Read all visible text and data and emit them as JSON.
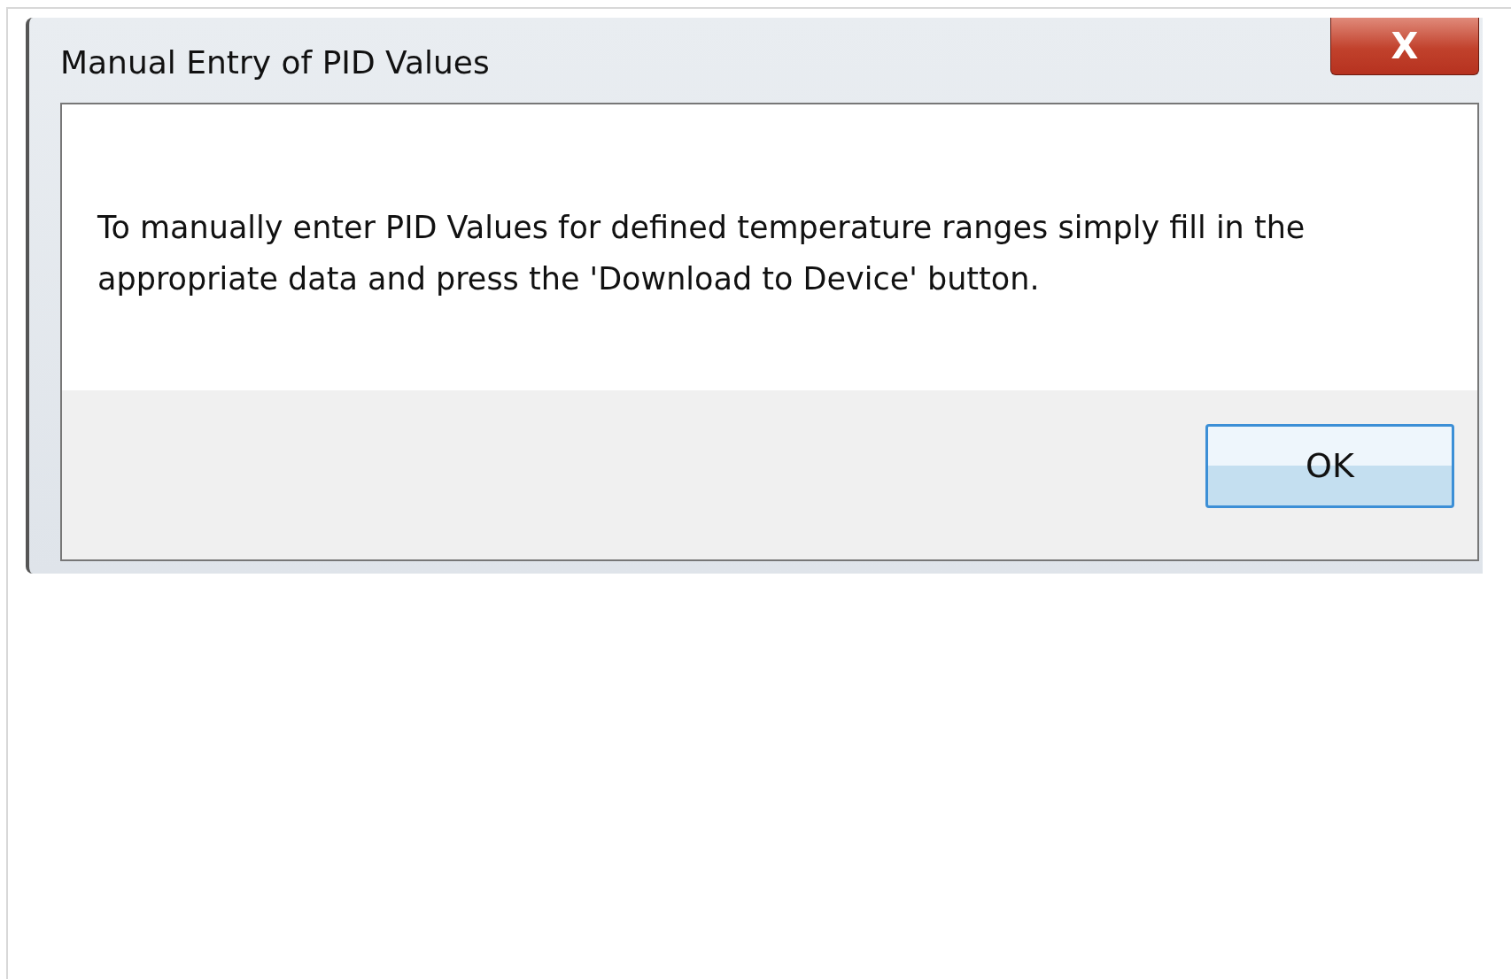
{
  "window": {
    "title": "Manual Entry of PID Values",
    "close_label": "X"
  },
  "message": "To manually enter PID Values for defined temperature ranges simply fill in the appropriate data and press the 'Download to Device' button.",
  "buttons": [
    {
      "label": "OK",
      "focused": true
    }
  ]
}
